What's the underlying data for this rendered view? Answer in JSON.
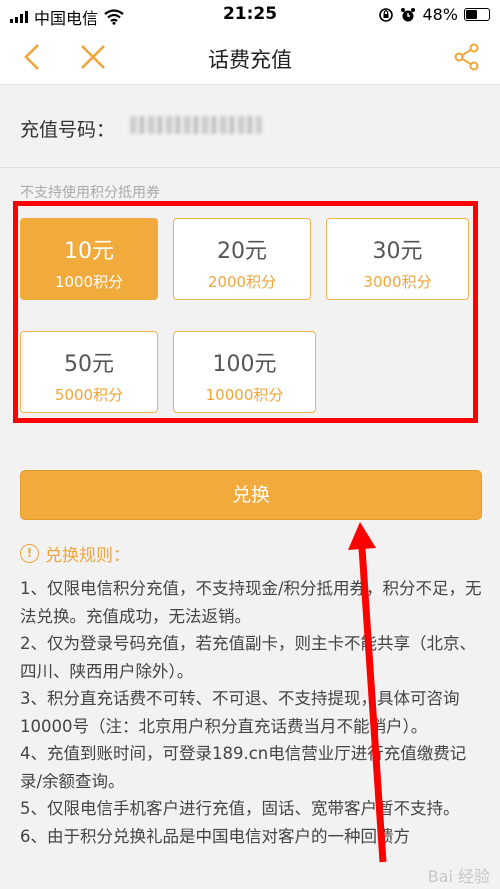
{
  "status_bar": {
    "carrier": "中国电信",
    "time": "21:25",
    "battery": "48%"
  },
  "nav": {
    "title": "话费充值"
  },
  "phone": {
    "label": "充值号码："
  },
  "notice": "不支持使用积分抵用券",
  "options": [
    {
      "amount": "10元",
      "points": "1000积分",
      "selected": true
    },
    {
      "amount": "20元",
      "points": "2000积分",
      "selected": false
    },
    {
      "amount": "30元",
      "points": "3000积分",
      "selected": false
    },
    {
      "amount": "50元",
      "points": "5000积分",
      "selected": false
    },
    {
      "amount": "100元",
      "points": "10000积分",
      "selected": false
    }
  ],
  "button_label": "兑换",
  "rules": {
    "title": "兑换规则：",
    "items": [
      "1、仅限电信积分充值，不支持现金/积分抵用券，积分不足，无法兑换。充值成功，无法返销。",
      "2、仅为登录号码充值，若充值副卡，则主卡不能共享（北京、四川、陕西用户除外）。",
      "3、积分直充话费不可转、不可退、不支持提现，具体可咨询10000号（注：北京用户积分直充话费当月不能销户）。",
      "4、充值到账时间，可登录189.cn电信营业厅进行充值缴费记录/余额查询。",
      "5、仅限电信手机客户进行充值，固话、宽带客户暂不支持。",
      "6、由于积分兑换礼品是中国电信对客户的一种回馈方"
    ]
  },
  "watermark": "Bai 经验",
  "colors": {
    "accent": "#f0ab3c",
    "highlight": "#ff0000"
  },
  "icons": [
    "back-icon",
    "close-icon",
    "share-icon",
    "wifi-icon",
    "alarm-icon",
    "battery-icon",
    "info-icon"
  ]
}
